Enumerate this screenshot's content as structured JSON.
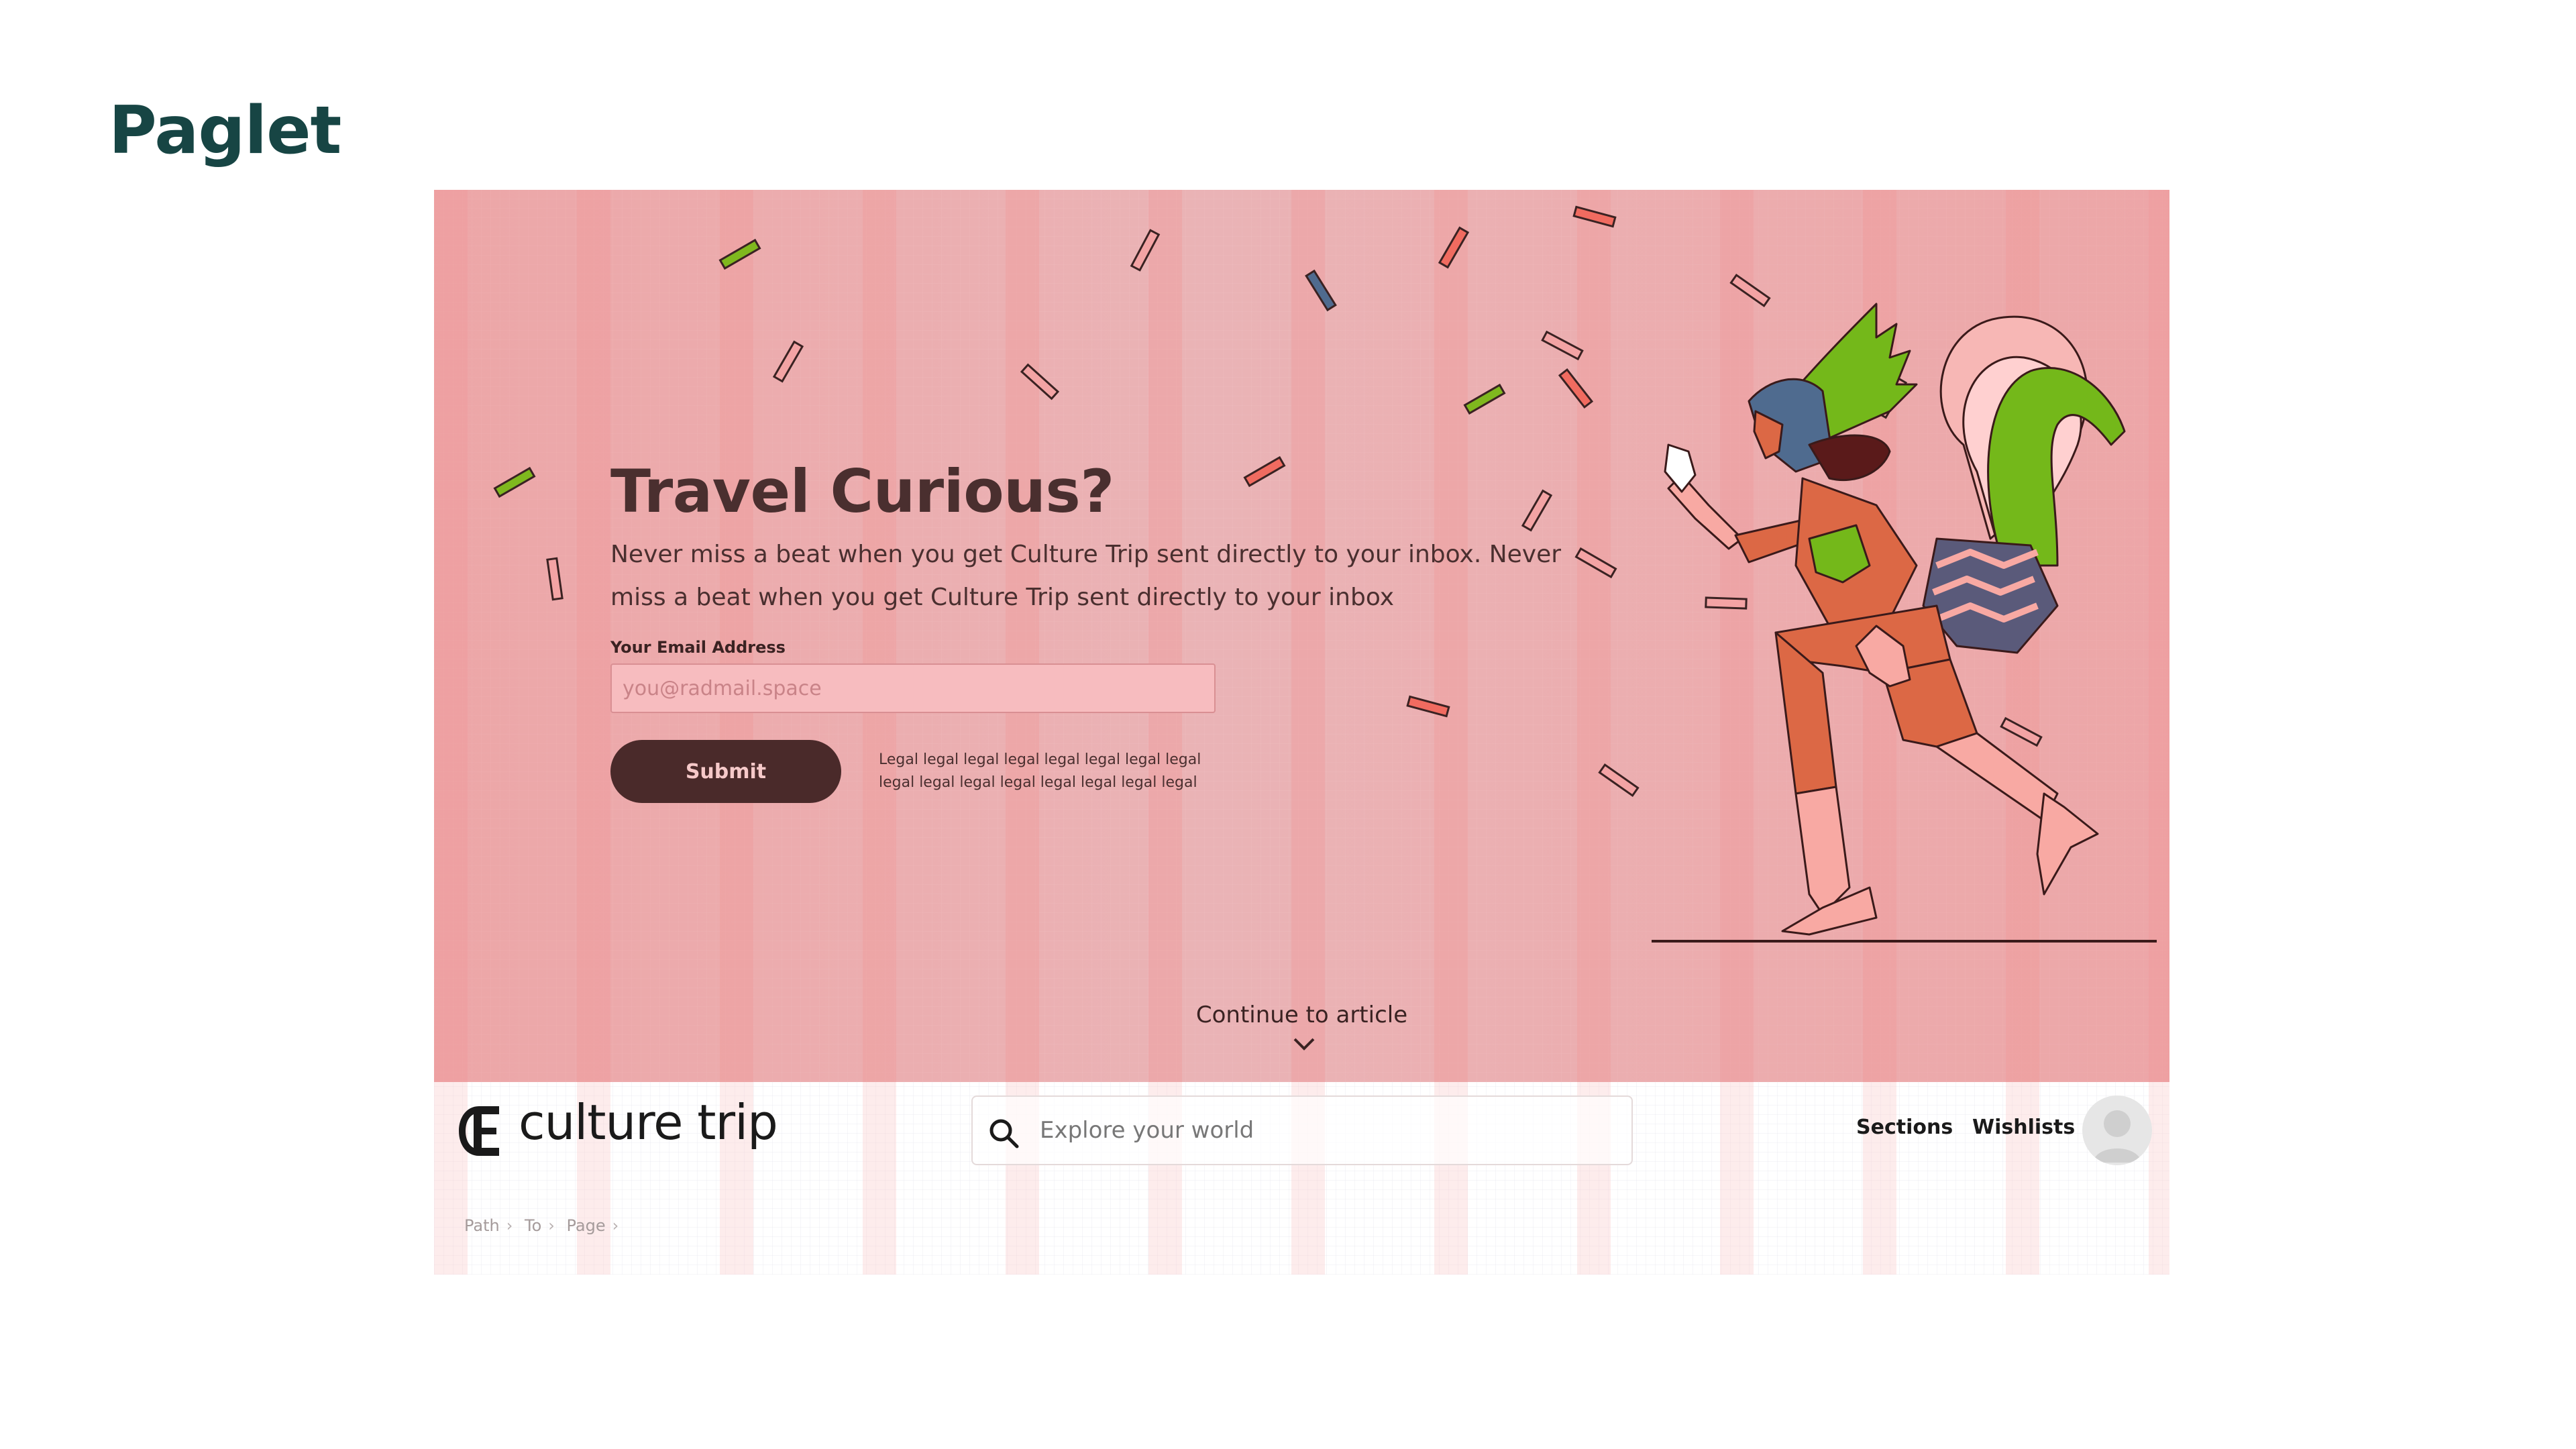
{
  "page": {
    "title": "Paglet"
  },
  "hero": {
    "heading": "Travel Curious?",
    "copy": "Never miss a beat when you get Culture Trip sent directly to your inbox. Never miss a beat when you get Culture Trip sent directly to your inbox",
    "email_label": "Your Email Address",
    "email_placeholder": "you@radmail.space",
    "submit_label": "Submit",
    "legal": "Legal legal legal legal legal legal legal legal legal legal legal legal legal legal legal legal",
    "continue_label": "Continue to article"
  },
  "header": {
    "logo_text": "culture trip",
    "search_placeholder": "Explore your world",
    "nav": [
      {
        "label": "Sections"
      },
      {
        "label": "Wishlists"
      }
    ]
  },
  "breadcrumb": [
    "Path",
    "To",
    "Page"
  ],
  "colors": {
    "hero_bg": "#ebb4b6",
    "text_dark": "#4a2f2f",
    "button_bg": "#4a2a2a",
    "brand_title": "#174544",
    "confetti_green": "#7fb81e",
    "confetti_red": "#f06b60",
    "confetti_blue": "#4f6b8f"
  },
  "icons": [
    "logo-icon",
    "search-icon",
    "avatar-icon",
    "chevron-down-icon"
  ]
}
